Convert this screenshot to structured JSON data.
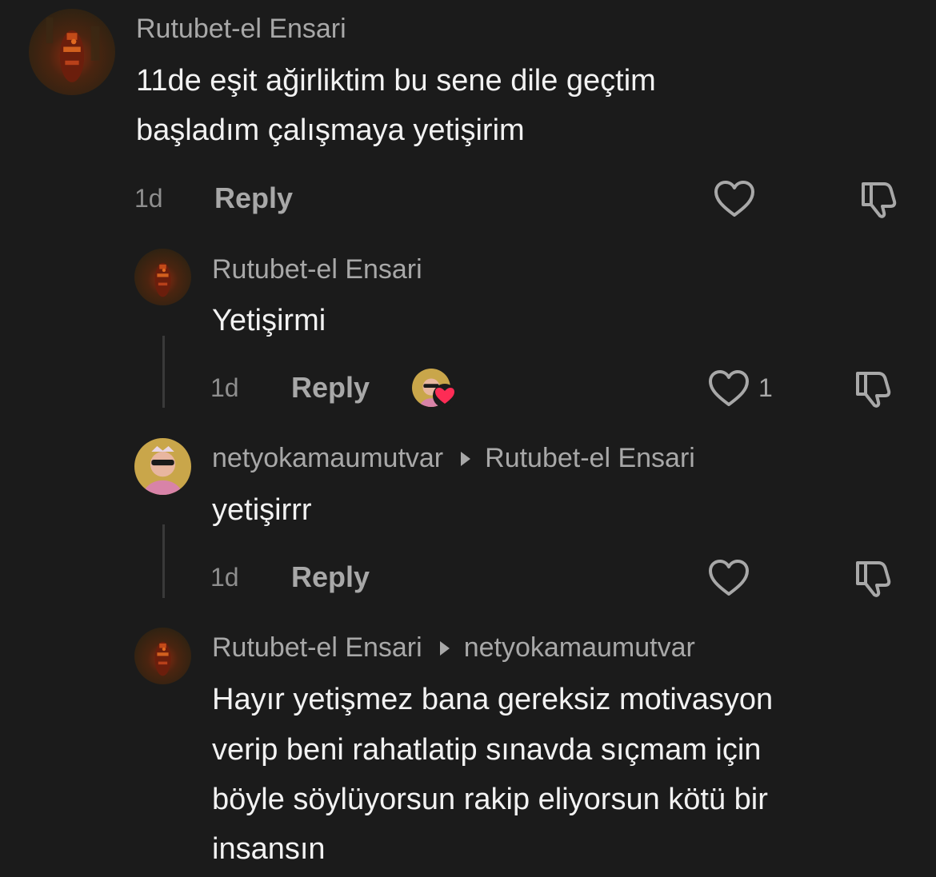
{
  "comments": [
    {
      "username": "Rutubet-el Ensari",
      "lines": [
        "11de eşit ağirliktim bu sene dile geçtim",
        "başladım çalışmaya yetişirim"
      ],
      "time": "1d",
      "reply_label": "Reply",
      "avatar_icon": "profile-photo-dark-red"
    },
    {
      "username": "Rutubet-el Ensari",
      "lines": [
        "Yetişirmi"
      ],
      "time": "1d",
      "reply_label": "Reply",
      "like_count": "1",
      "liked_by_creator": true,
      "avatar_icon": "profile-photo-dark-red"
    },
    {
      "username": "netyokamaumutvar",
      "reply_to": "Rutubet-el Ensari",
      "lines": [
        "yetişirrr"
      ],
      "time": "1d",
      "reply_label": "Reply",
      "avatar_icon": "profile-photo-child-sunglasses"
    },
    {
      "username": "Rutubet-el Ensari",
      "reply_to": "netyokamaumutvar",
      "lines": [
        "Hayır yetişmez bana gereksiz motivasyon",
        "verip beni rahatlatip sınavda sıçmam için",
        "böyle söylüyorsun rakip eliyorsun kötü bir",
        "insansın"
      ],
      "avatar_icon": "profile-photo-dark-red"
    }
  ],
  "colors": {
    "background": "#1b1b1b",
    "username": "#a8a8a8",
    "body": "#f2f2f2",
    "heart_badge": "#fe2c55"
  }
}
